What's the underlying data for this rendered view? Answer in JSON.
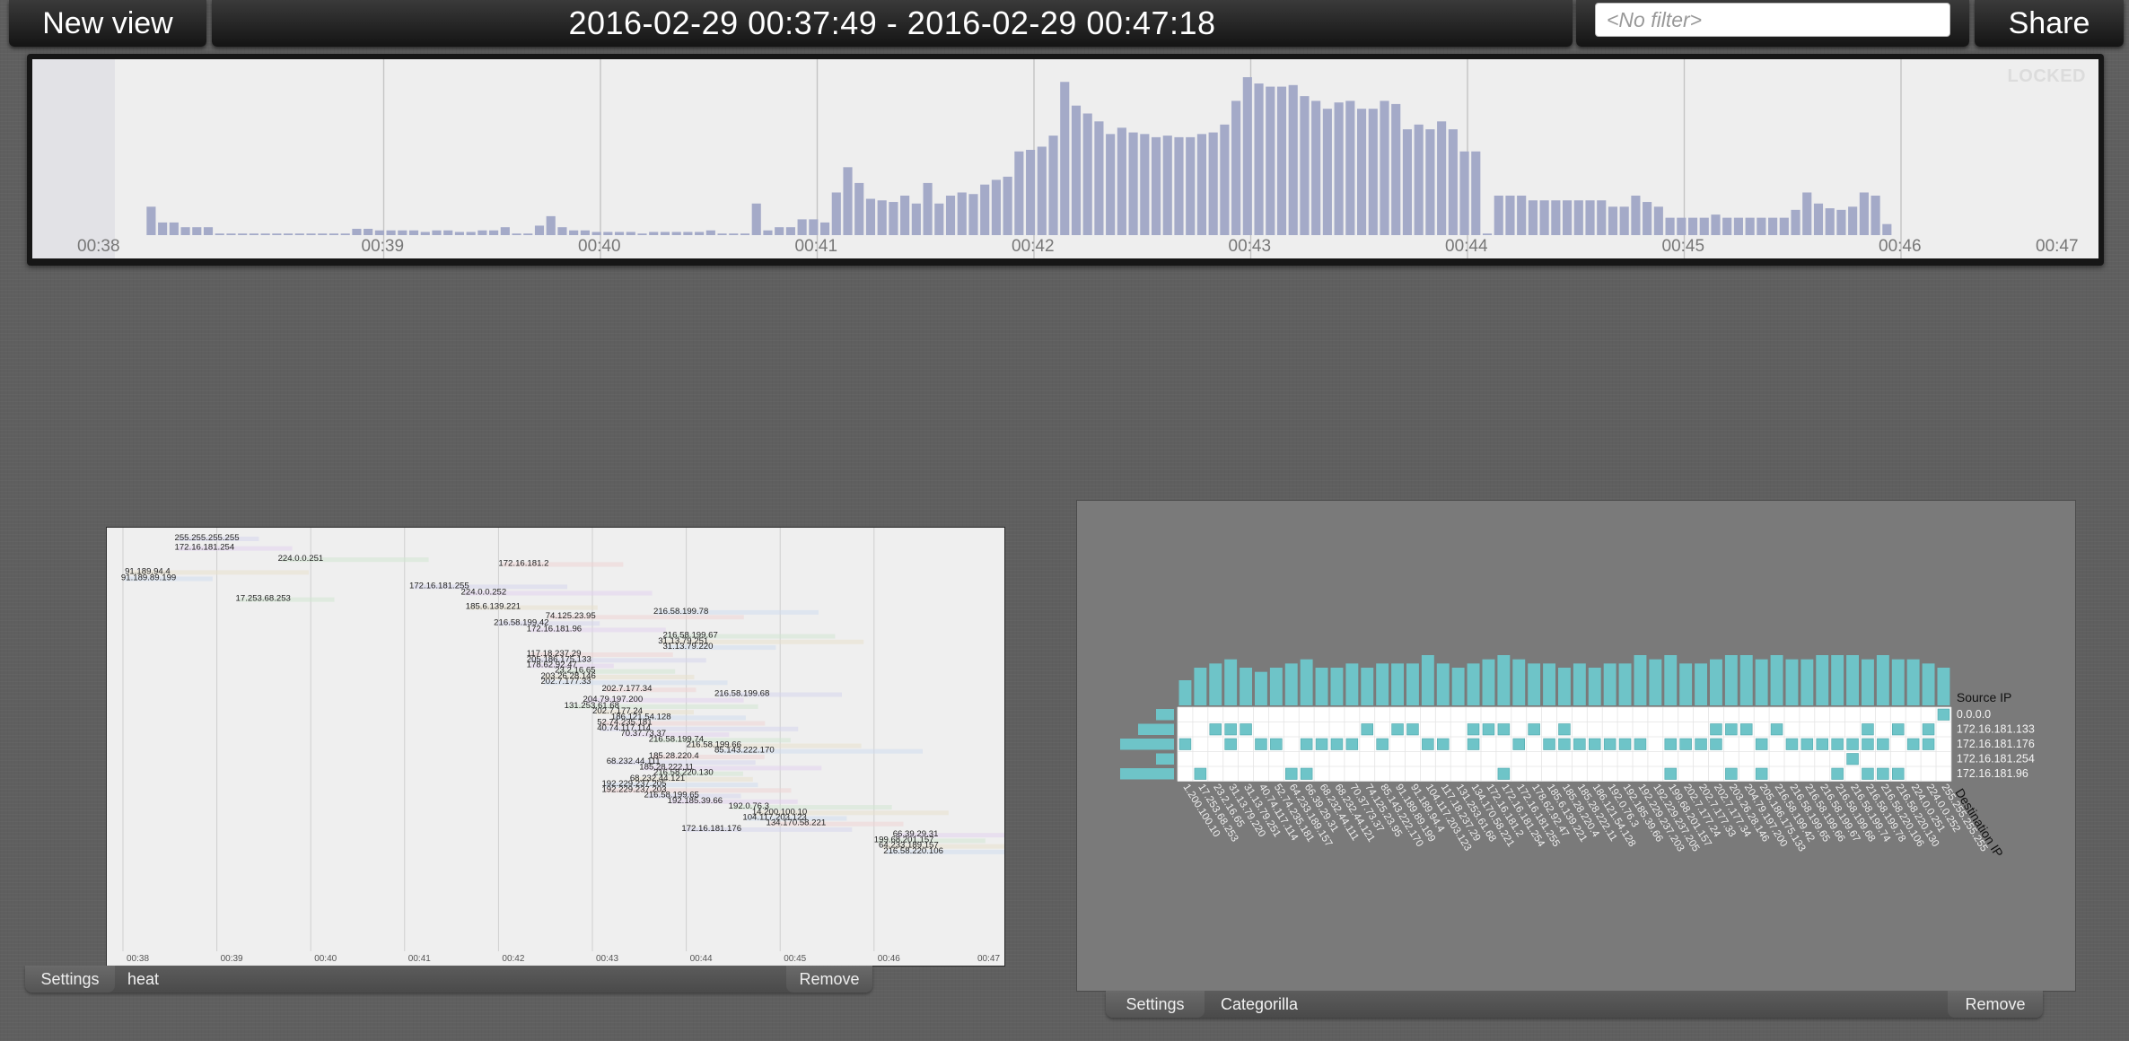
{
  "topbar": {
    "new_view_label": "New view",
    "time_range": "2016-02-29 00:37:49 - 2016-02-29 00:47:18",
    "filter_placeholder": "<No filter>",
    "share_label": "Share"
  },
  "timeline": {
    "locked_label": "LOCKED",
    "bar_color": "#a4aac8",
    "chart_data": {
      "type": "bar",
      "x_tick_labels": [
        "00:38",
        "00:39",
        "00:40",
        "00:41",
        "00:42",
        "00:43",
        "00:44",
        "00:45",
        "00:46",
        "00:47"
      ],
      "values": [
        0,
        0,
        0,
        0,
        0,
        0,
        18,
        8,
        8,
        5,
        5,
        5,
        1,
        1,
        1,
        1,
        1,
        1,
        1,
        1,
        1,
        1,
        1,
        1,
        4,
        4,
        3,
        3,
        3,
        3,
        2,
        3,
        3,
        2,
        2,
        3,
        3,
        5,
        1,
        1,
        6,
        12,
        5,
        3,
        3,
        2,
        2,
        2,
        2,
        1,
        2,
        2,
        2,
        2,
        2,
        3,
        1,
        1,
        1,
        20,
        3,
        5,
        5,
        10,
        10,
        8,
        27,
        43,
        33,
        23,
        22,
        21,
        25,
        20,
        33,
        20,
        25,
        27,
        26,
        32,
        35,
        37,
        53,
        54,
        56,
        63,
        97,
        82,
        77,
        72,
        64,
        68,
        65,
        64,
        62,
        63,
        62,
        62,
        64,
        65,
        70,
        85,
        100,
        96,
        94,
        94,
        95,
        88,
        85,
        80,
        84,
        85,
        80,
        80,
        85,
        83,
        67,
        70,
        67,
        72,
        67,
        53,
        53,
        1,
        25,
        25,
        25,
        22,
        22,
        22,
        22,
        22,
        22,
        22,
        18,
        18,
        25,
        21,
        18,
        11,
        11,
        11,
        11,
        13,
        11,
        11,
        11,
        11,
        11,
        11,
        16,
        27,
        20,
        17,
        16,
        18,
        27,
        25,
        7,
        0,
        0,
        0,
        0,
        0,
        0,
        0,
        0,
        0,
        0,
        0,
        0,
        0,
        0,
        0,
        0,
        0,
        0
      ],
      "ylim": [
        0,
        100
      ]
    }
  },
  "heat_panel": {
    "settings_label": "Settings",
    "name_label": "heat",
    "remove_label": "Remove",
    "chart_data": {
      "type": "scatter",
      "x_tick_labels": [
        "00:38",
        "00:39",
        "00:40",
        "00:41",
        "00:42",
        "00:43",
        "00:44",
        "00:45",
        "00:46",
        "00:47"
      ],
      "labels": [
        {
          "text": "255.255.255.255",
          "t": 0.55,
          "row": 0
        },
        {
          "text": "172.16.181.254",
          "t": 0.55,
          "row": 0.6
        },
        {
          "text": "224.0.0.251",
          "t": 1.65,
          "row": 1.3
        },
        {
          "text": "91.189.94.4",
          "t": 0.02,
          "row": 2.1
        },
        {
          "text": "91.189.89.199",
          "t": -0.02,
          "row": 2.5
        },
        {
          "text": "172.16.181.2",
          "t": 4.0,
          "row": 1.6
        },
        {
          "text": "172.16.181.255",
          "t": 3.05,
          "row": 3.0
        },
        {
          "text": "224.0.0.252",
          "t": 3.6,
          "row": 3.4
        },
        {
          "text": "17.253.68.253",
          "t": 1.2,
          "row": 3.8
        },
        {
          "text": "185.6.139.221",
          "t": 3.65,
          "row": 4.3
        },
        {
          "text": "216.58.199.78",
          "t": 5.65,
          "row": 4.6
        },
        {
          "text": "74.125.23.95",
          "t": 4.5,
          "row": 4.9
        },
        {
          "text": "216.58.199.42",
          "t": 3.95,
          "row": 5.3
        },
        {
          "text": "172.16.181.96",
          "t": 4.3,
          "row": 5.7
        },
        {
          "text": "216.58.199.67",
          "t": 5.75,
          "row": 6.1
        },
        {
          "text": "31.13.79.251",
          "t": 5.7,
          "row": 6.45
        },
        {
          "text": "31.13.79.220",
          "t": 5.75,
          "row": 6.8
        },
        {
          "text": "117.18.237.29",
          "t": 4.3,
          "row": 7.25
        },
        {
          "text": "205.186.175.133",
          "t": 4.3,
          "row": 7.6
        },
        {
          "text": "178.62.92.47",
          "t": 4.3,
          "row": 7.95
        },
        {
          "text": "23.2.16.65",
          "t": 4.6,
          "row": 8.3
        },
        {
          "text": "203.26.28.146",
          "t": 4.45,
          "row": 8.65
        },
        {
          "text": "202.7.177.33",
          "t": 4.45,
          "row": 9.0
        },
        {
          "text": "202.7.177.34",
          "t": 5.1,
          "row": 9.45
        },
        {
          "text": "216.58.199.68",
          "t": 6.3,
          "row": 9.75
        },
        {
          "text": "204.79.197.200",
          "t": 4.9,
          "row": 10.1
        },
        {
          "text": "131.253.61.68",
          "t": 4.7,
          "row": 10.5
        },
        {
          "text": "202.7.177.24",
          "t": 5.0,
          "row": 10.85
        },
        {
          "text": "186.121.54.128",
          "t": 5.2,
          "row": 11.2
        },
        {
          "text": "52.74.235.181",
          "t": 5.05,
          "row": 11.55
        },
        {
          "text": "40.74.117.114",
          "t": 5.05,
          "row": 11.9
        },
        {
          "text": "70.37.73.37",
          "t": 5.3,
          "row": 12.25
        },
        {
          "text": "216.58.199.74",
          "t": 5.6,
          "row": 12.6
        },
        {
          "text": "216.58.199.66",
          "t": 6.0,
          "row": 12.95
        },
        {
          "text": "85.143.222.170",
          "t": 6.3,
          "row": 13.3
        },
        {
          "text": "185.28.220.4",
          "t": 5.6,
          "row": 13.65
        },
        {
          "text": "68.232.44.111",
          "t": 5.15,
          "row": 14.0
        },
        {
          "text": "185.28.222.11",
          "t": 5.5,
          "row": 14.35
        },
        {
          "text": "216.58.220.130",
          "t": 5.65,
          "row": 14.7
        },
        {
          "text": "68.232.44.121",
          "t": 5.4,
          "row": 15.05
        },
        {
          "text": "192.229.237.205",
          "t": 5.1,
          "row": 15.4
        },
        {
          "text": "192.229.237.203",
          "t": 5.1,
          "row": 15.75
        },
        {
          "text": "216.58.199.65",
          "t": 5.55,
          "row": 16.1
        },
        {
          "text": "192.185.39.66",
          "t": 5.8,
          "row": 16.45
        },
        {
          "text": "192.0.76.3",
          "t": 6.45,
          "row": 16.8
        },
        {
          "text": "14.200.100.10",
          "t": 6.7,
          "row": 17.15
        },
        {
          "text": "104.117.203.123",
          "t": 6.6,
          "row": 17.5
        },
        {
          "text": "134.170.58.221",
          "t": 6.85,
          "row": 17.85
        },
        {
          "text": "172.16.181.176",
          "t": 5.95,
          "row": 18.2
        },
        {
          "text": "66.39.29.31",
          "t": 8.2,
          "row": 18.55
        },
        {
          "text": "199.68.201.157",
          "t": 8.0,
          "row": 18.9
        },
        {
          "text": "64.233.189.157",
          "t": 8.05,
          "row": 19.25
        },
        {
          "text": "216.58.220.106",
          "t": 8.1,
          "row": 19.6
        }
      ]
    }
  },
  "cat_panel": {
    "settings_label": "Settings",
    "name_label": "Categorilla",
    "remove_label": "Remove",
    "bar_color": "#6ec4c8",
    "chart_data": {
      "type": "heatmap",
      "title": "",
      "y_axis_label": "Source IP",
      "x_axis_label": "Destination IP",
      "source_ips": [
        "0.0.0.0",
        "172.16.181.133",
        "172.16.181.176",
        "172.16.181.254",
        "172.16.181.96"
      ],
      "source_counts": [
        1,
        2,
        3,
        1,
        3
      ],
      "destination_ips": [
        "1.200.100.10",
        "17.253.68.253",
        "23.2.16.65",
        "31.13.79.220",
        "31.13.79.251",
        "40.74.117.114",
        "52.74.235.181",
        "64.233.189.157",
        "66.39.29.31",
        "68.232.44.111",
        "68.232.44.121",
        "70.37.73.37",
        "74.125.23.95",
        "85.143.222.170",
        "91.189.89.199",
        "91.189.94.4",
        "104.117.203.123",
        "117.18.237.29",
        "131.253.61.68",
        "134.170.58.221",
        "172.16.181.2",
        "172.16.181.254",
        "172.16.181.255",
        "178.62.92.47",
        "185.6.139.221",
        "185.28.220.4",
        "185.28.222.11",
        "186.121.54.128",
        "192.0.76.3",
        "192.185.39.66",
        "192.229.237.203",
        "192.229.237.205",
        "199.68.201.157",
        "202.7.177.24",
        "202.7.177.33",
        "202.7.177.34",
        "203.26.28.146",
        "204.79.197.200",
        "205.186.175.133",
        "216.58.199.42",
        "216.58.199.65",
        "216.58.199.66",
        "216.58.199.67",
        "216.58.199.68",
        "216.58.199.74",
        "216.58.199.78",
        "216.58.220.106",
        "216.58.220.130",
        "224.0.0.251",
        "224.0.0.252",
        "255.255.255.255"
      ],
      "destination_counts": [
        6,
        9,
        10,
        11,
        9,
        8,
        9,
        10,
        11,
        9,
        9,
        10,
        9,
        10,
        10,
        10,
        12,
        10,
        9,
        10,
        11,
        12,
        11,
        10,
        10,
        9,
        10,
        9,
        10,
        10,
        12,
        11,
        12,
        10,
        10,
        11,
        12,
        12,
        11,
        12,
        11,
        11,
        12,
        12,
        12,
        11,
        12,
        11,
        11,
        10,
        9
      ],
      "cells": [
        [
          0,
          0,
          0,
          0,
          0,
          0,
          0,
          0,
          0,
          0,
          0,
          0,
          0,
          0,
          0,
          0,
          0,
          0,
          0,
          0,
          0,
          0,
          0,
          0,
          0,
          0,
          0,
          0,
          0,
          0,
          0,
          0,
          0,
          0,
          0,
          0,
          0,
          0,
          0,
          0,
          0,
          0,
          0,
          0,
          0,
          0,
          0,
          0,
          0,
          0,
          1
        ],
        [
          0,
          0,
          1,
          1,
          1,
          0,
          0,
          0,
          0,
          0,
          0,
          0,
          1,
          0,
          1,
          1,
          0,
          0,
          0,
          1,
          1,
          1,
          0,
          1,
          0,
          1,
          0,
          0,
          0,
          0,
          0,
          0,
          0,
          0,
          0,
          1,
          1,
          1,
          0,
          1,
          0,
          0,
          0,
          0,
          0,
          1,
          0,
          1,
          0,
          1,
          0
        ],
        [
          1,
          0,
          0,
          1,
          0,
          1,
          1,
          0,
          1,
          1,
          1,
          1,
          0,
          1,
          0,
          0,
          1,
          1,
          0,
          1,
          0,
          0,
          1,
          0,
          1,
          1,
          1,
          1,
          1,
          1,
          1,
          0,
          1,
          1,
          1,
          1,
          0,
          0,
          1,
          0,
          1,
          1,
          1,
          1,
          1,
          1,
          1,
          0,
          1,
          1,
          0
        ],
        [
          0,
          0,
          0,
          0,
          0,
          0,
          0,
          0,
          0,
          0,
          0,
          0,
          0,
          0,
          0,
          0,
          0,
          0,
          0,
          0,
          0,
          0,
          0,
          0,
          0,
          0,
          0,
          0,
          0,
          0,
          0,
          0,
          0,
          0,
          0,
          0,
          0,
          0,
          0,
          0,
          0,
          0,
          0,
          0,
          1,
          0,
          0,
          0,
          0,
          0,
          0
        ],
        [
          0,
          1,
          0,
          0,
          0,
          0,
          0,
          1,
          1,
          0,
          0,
          0,
          0,
          0,
          0,
          0,
          0,
          0,
          0,
          0,
          0,
          1,
          0,
          0,
          0,
          0,
          0,
          0,
          0,
          0,
          0,
          0,
          1,
          0,
          0,
          0,
          1,
          0,
          1,
          0,
          0,
          0,
          0,
          1,
          0,
          1,
          1,
          1,
          0,
          0,
          0
        ]
      ]
    }
  }
}
